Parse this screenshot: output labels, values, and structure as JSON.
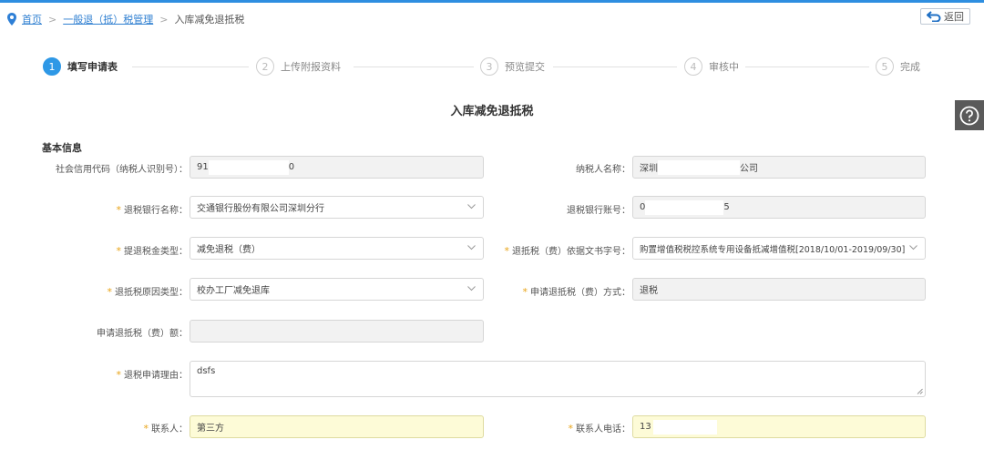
{
  "breadcrumb": {
    "home": "首页",
    "level2": "一般退（抵）税管理",
    "current": "入库减免退抵税",
    "separator": ">"
  },
  "back_button": {
    "label": "返回"
  },
  "steps": [
    {
      "num": "1",
      "label": "填写申请表"
    },
    {
      "num": "2",
      "label": "上传附报资料"
    },
    {
      "num": "3",
      "label": "预览提交"
    },
    {
      "num": "4",
      "label": "审核中"
    },
    {
      "num": "5",
      "label": "完成"
    }
  ],
  "form": {
    "title": "入库减免退抵税",
    "section": "基本信息",
    "fields": {
      "credit_code": {
        "label": "社会信用代码（纳税人识别号）：",
        "value_prefix": "91",
        "value_suffix": "0"
      },
      "taxpayer_name": {
        "label": "纳税人名称：",
        "value_prefix": "深圳",
        "value_suffix": "公司"
      },
      "refund_bank": {
        "label": "退税银行名称：",
        "value": "交通银行股份有限公司深圳分行"
      },
      "bank_account": {
        "label": "退税银行账号：",
        "value_prefix": "0",
        "value_suffix": "5"
      },
      "refund_type": {
        "label": "提退税金类型：",
        "value": "减免退税（费）"
      },
      "doc_number": {
        "label": "退抵税（费）依据文书字号：",
        "value": "购置增值税税控系统专用设备抵减增值税[2018/10/01-2019/09/30]"
      },
      "reason_type": {
        "label": "退抵税原因类型：",
        "value": "校办工厂减免退库"
      },
      "refund_method": {
        "label": "申请退抵税（费）方式：",
        "value": "退税"
      },
      "refund_amount": {
        "label": "申请退抵税（费）额：",
        "value": ""
      },
      "reason": {
        "label": "退税申请理由：",
        "value": "dsfs"
      },
      "contact": {
        "label": "联系人：",
        "value": "第三方"
      },
      "phone": {
        "label": "联系人电话：",
        "value_prefix": "13"
      }
    },
    "required_mark": "*"
  },
  "colors": {
    "accent": "#2e98e6",
    "required": "#e8a317",
    "highlight": "#fdfbd7"
  },
  "icons": {
    "location": "location-pin-icon",
    "back": "return-arrow-icon",
    "help": "question-circle-icon",
    "dropdown": "chevron-down-icon"
  }
}
